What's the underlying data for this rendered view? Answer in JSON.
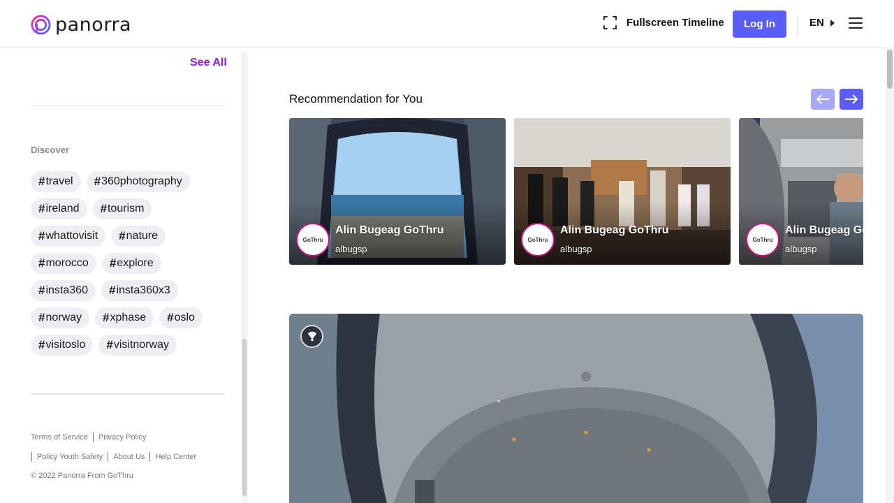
{
  "header": {
    "logo_text": "panorra",
    "fullscreen_label": "Fullscreen Timeline",
    "login_label": "Log In",
    "language": "EN",
    "brand_color": "#5b5ef6"
  },
  "sidebar": {
    "see_all_label": "See All",
    "discover_label": "Discover",
    "tags": [
      [
        "travel",
        "360photography"
      ],
      [
        "ireland",
        "tourism"
      ],
      [
        "whattovisit",
        "nature"
      ],
      [
        "morocco",
        "explore"
      ],
      [
        "insta360",
        "insta360x3"
      ],
      [
        "norway",
        "xphase",
        "oslo"
      ],
      [
        "visitoslo",
        "visitnorway"
      ]
    ],
    "footer": {
      "terms": "Terms of Service",
      "privacy": "Privacy Policy",
      "youth": "Policy Youth Safety",
      "about": "About Us",
      "help": "Help Center",
      "copyright": "© 2022 Panorra From GoThru"
    }
  },
  "main": {
    "section_title": "Recommendation for You",
    "cards": [
      {
        "author": "Alin Bugeag GoThru",
        "handle": "albugsp",
        "avatar_text": "GoThru"
      },
      {
        "author": "Alin Bugeag GoThru",
        "handle": "albugsp",
        "avatar_text": "GoThru"
      },
      {
        "author": "Alin Bugeag GoThru",
        "handle": "albugsp",
        "avatar_text": "GoThru"
      }
    ]
  },
  "icons": {
    "fullscreen": "fullscreen-icon",
    "language_caret": "caret-right-icon",
    "menu": "hamburger-menu-icon",
    "prev": "arrow-left-icon",
    "next": "arrow-right-icon",
    "compass": "compass-icon"
  }
}
